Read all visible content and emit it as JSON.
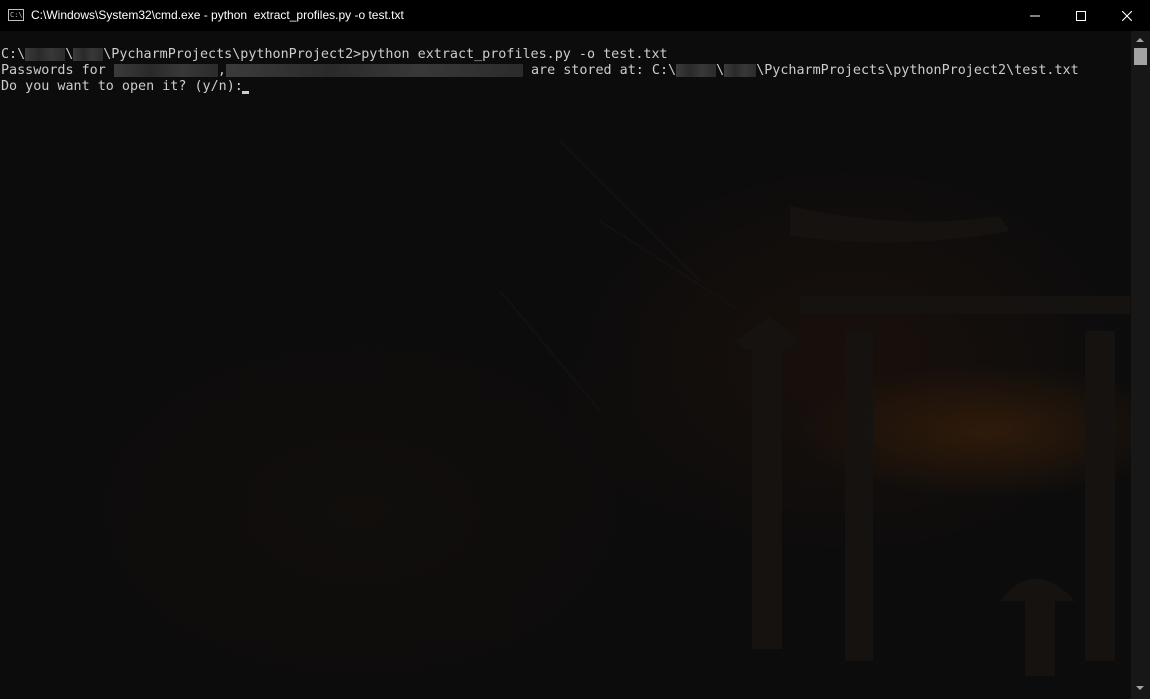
{
  "window": {
    "title": "C:\\Windows\\System32\\cmd.exe - python  extract_profiles.py -o test.txt",
    "icon": "cmd-icon",
    "icon_text": "C:\\",
    "controls": [
      "minimize-icon",
      "maximize-icon",
      "close-icon"
    ]
  },
  "terminal": {
    "line1": {
      "drive": "C:\\",
      "sep": "\\",
      "path_rest": "\\PycharmProjects\\pythonProject2>",
      "command": "python extract_profiles.py -o test.txt"
    },
    "line2": {
      "prefix": "Passwords for ",
      "comma": ",",
      "middle": " are stored at: C:\\",
      "sep": "\\",
      "suffix": "\\PycharmProjects\\pythonProject2\\test.txt"
    },
    "line3": {
      "prompt": "Do you want to open it? (y/n):"
    }
  },
  "colors": {
    "text": "#cccccc",
    "background": "#0c0c0c",
    "titlebar": "#000000"
  }
}
